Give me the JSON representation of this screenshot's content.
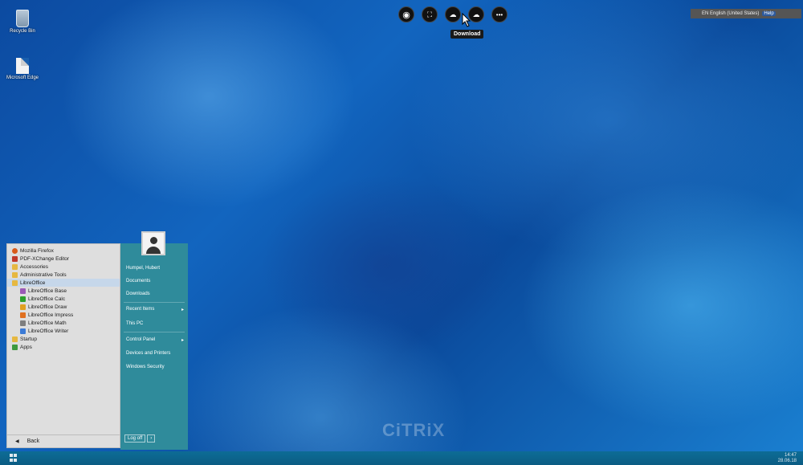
{
  "desktop": {
    "icons": [
      {
        "label": "Recycle Bin",
        "icon": "recycle-bin-icon"
      },
      {
        "label": "Microsoft Edge",
        "icon": "file-shortcut-icon"
      }
    ],
    "watermark": "CiTRiX"
  },
  "citrix_toolbar": {
    "buttons": [
      {
        "name": "citrix-home",
        "icon": "citrix-receiver-icon"
      },
      {
        "name": "fullscreen",
        "icon": "fullscreen-icon"
      },
      {
        "name": "download",
        "icon": "download-cloud-icon"
      },
      {
        "name": "upload",
        "icon": "upload-cloud-icon"
      },
      {
        "name": "more",
        "icon": "ellipsis-icon"
      }
    ],
    "tooltip": "Download"
  },
  "language_bar": {
    "label": "EN English (United States)",
    "help": "Help"
  },
  "start_menu": {
    "programs": [
      {
        "label": "Mozilla Firefox",
        "icon": "firefox",
        "level": 0
      },
      {
        "label": "PDF-XChange Editor",
        "icon": "pdf",
        "level": 0
      },
      {
        "label": "Accessories",
        "icon": "folder",
        "level": 0
      },
      {
        "label": "Administrative Tools",
        "icon": "folder",
        "level": 0
      },
      {
        "label": "LibreOffice",
        "icon": "folder",
        "level": 0,
        "selected": true
      },
      {
        "label": "LibreOffice Base",
        "icon": "base",
        "level": 1
      },
      {
        "label": "LibreOffice Calc",
        "icon": "calc",
        "level": 1
      },
      {
        "label": "LibreOffice Draw",
        "icon": "draw",
        "level": 1
      },
      {
        "label": "LibreOffice Impress",
        "icon": "impress",
        "level": 1
      },
      {
        "label": "LibreOffice Math",
        "icon": "math",
        "level": 1
      },
      {
        "label": "LibreOffice Writer",
        "icon": "writer",
        "level": 1
      },
      {
        "label": "Startup",
        "icon": "folder",
        "level": 0
      },
      {
        "label": "Apps",
        "icon": "apps",
        "level": 0
      }
    ],
    "back_label": "Back",
    "right_panel": {
      "user": "Humpel, Hubert",
      "documents": "Documents",
      "downloads": "Downloads",
      "recent_items": "Recent Items",
      "this_pc": "This PC",
      "control_panel": "Control Panel",
      "devices_printers": "Devices and Printers",
      "windows_security": "Windows Security",
      "log_off": "Log off",
      "log_off_arrow": "›"
    }
  },
  "taskbar": {
    "start_icon": "windows-logo-icon",
    "time": "14:47",
    "date": "28.06.18"
  }
}
